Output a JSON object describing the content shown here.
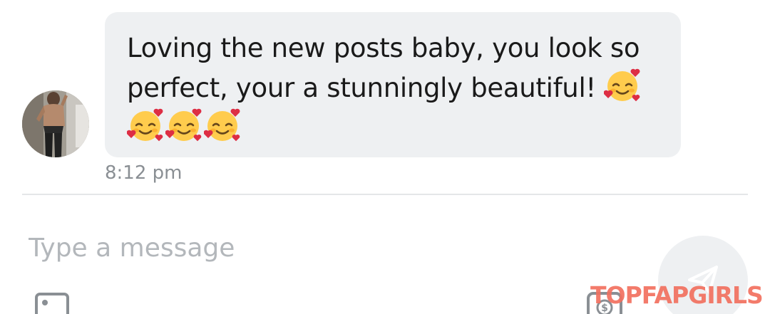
{
  "conversation": {
    "message": {
      "text": "Loving the new posts baby, you look so perfect, your a stunningly beautiful!",
      "emoji": "smiling-face-with-hearts",
      "time": "8:12 pm"
    }
  },
  "composer": {
    "placeholder": "Type a message"
  },
  "watermark": {
    "text": "TOPFAPGIRLS",
    "color": "#f2705f"
  },
  "colors": {
    "bubble": "#eef0f2",
    "text": "#1a1a1a",
    "timestamp": "#8a8f94",
    "placeholder": "#b3b7bb"
  }
}
